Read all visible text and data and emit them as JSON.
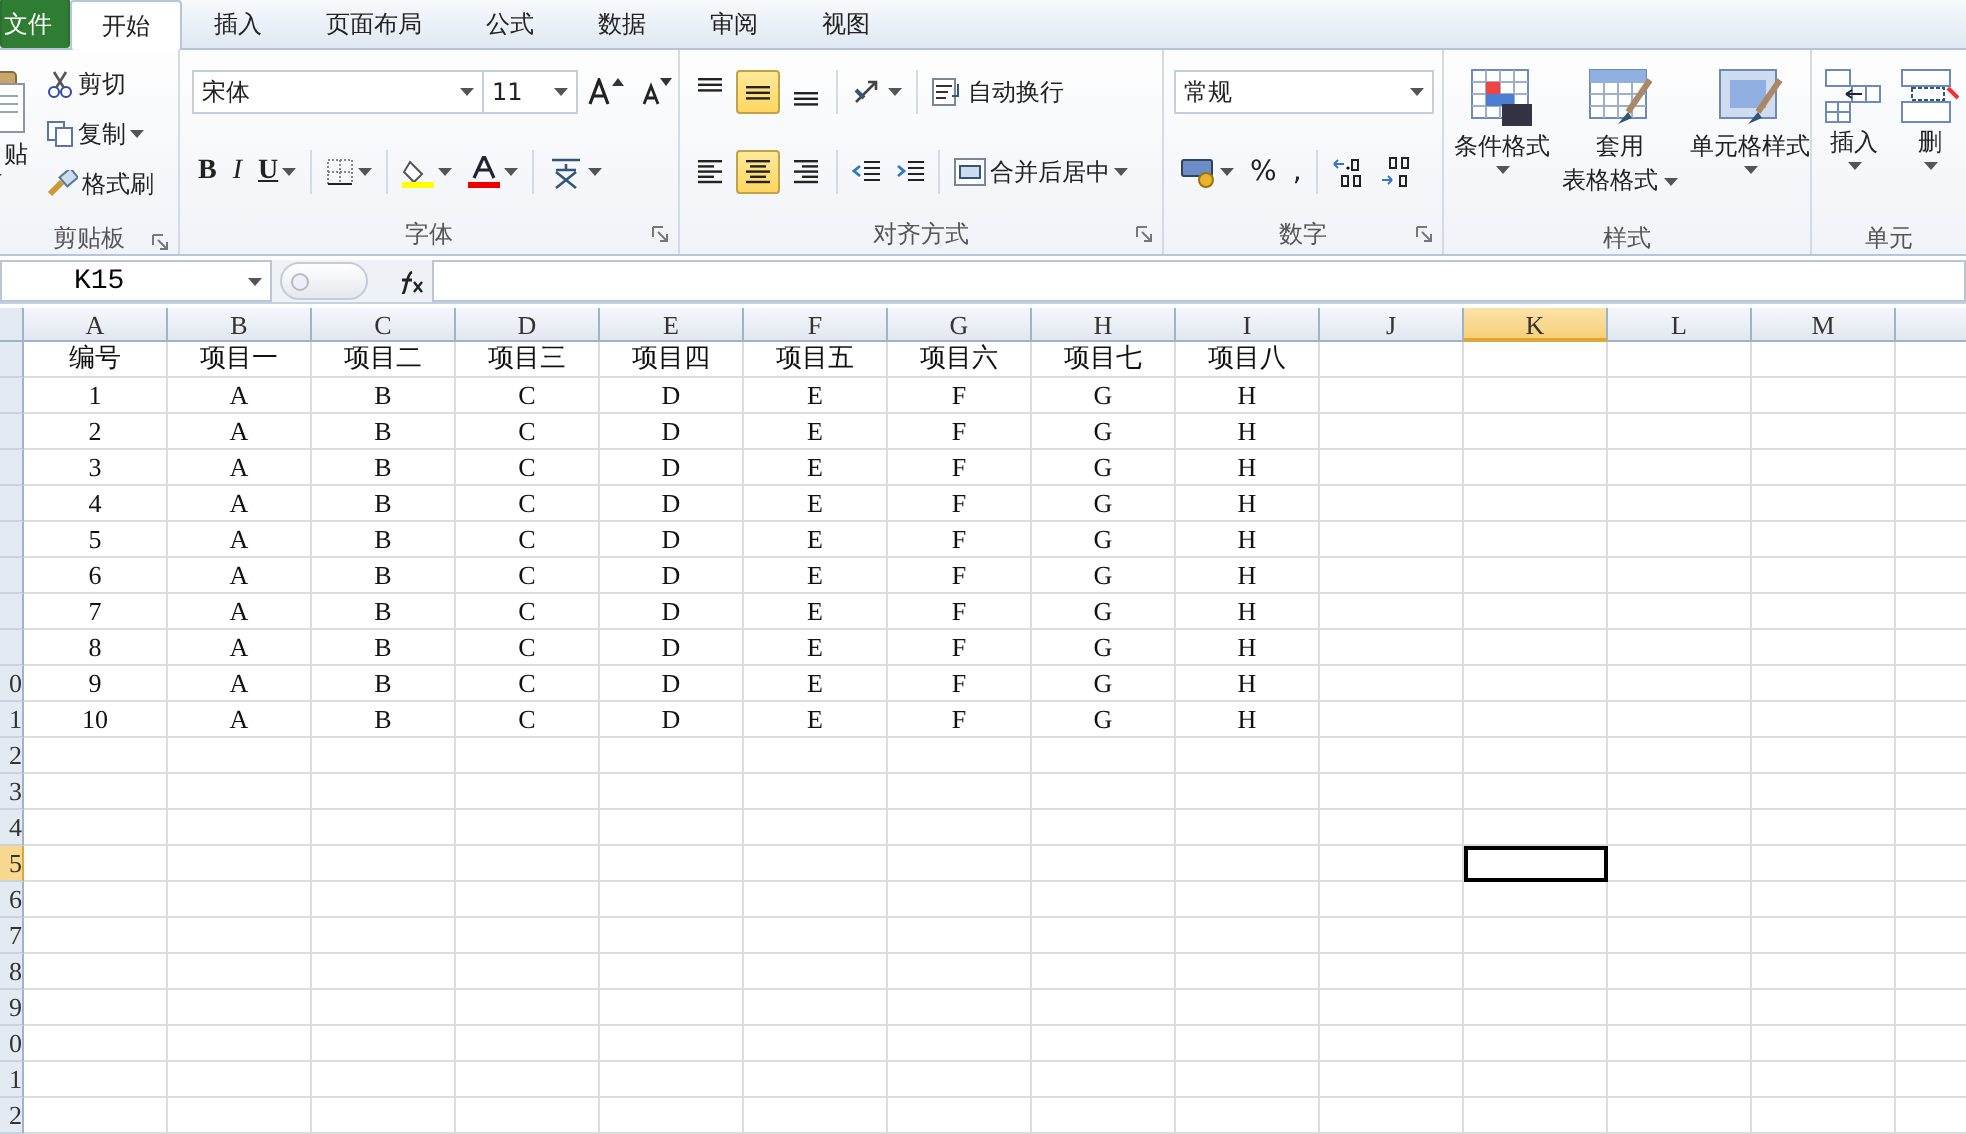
{
  "ribbon": {
    "tabs": [
      {
        "label": "文件",
        "kind": "file",
        "selected": false
      },
      {
        "label": "开始",
        "kind": "tab",
        "selected": true
      },
      {
        "label": "插入",
        "kind": "tab",
        "selected": false
      },
      {
        "label": "页面布局",
        "kind": "tab",
        "selected": false
      },
      {
        "label": "公式",
        "kind": "tab",
        "selected": false
      },
      {
        "label": "数据",
        "kind": "tab",
        "selected": false
      },
      {
        "label": "审阅",
        "kind": "tab",
        "selected": false
      },
      {
        "label": "视图",
        "kind": "tab",
        "selected": false
      }
    ],
    "clipboard": {
      "title": "剪贴板",
      "paste": "贴",
      "cut": "剪切",
      "copy": "复制",
      "format_painter": "格式刷"
    },
    "font": {
      "title": "字体",
      "font_name": "宋体",
      "font_size": "11",
      "bold": "B",
      "italic": "I",
      "underline": "U"
    },
    "alignment": {
      "title": "对齐方式",
      "wrap_text": "自动换行",
      "merge_center": "合并后居中",
      "vertical_buttons": [
        {
          "kind": "top",
          "selected": false
        },
        {
          "kind": "middle",
          "selected": true
        },
        {
          "kind": "bottom",
          "selected": false
        }
      ],
      "horizontal_buttons": [
        {
          "kind": "left",
          "selected": false
        },
        {
          "kind": "center",
          "selected": true
        },
        {
          "kind": "right",
          "selected": false
        }
      ]
    },
    "number": {
      "title": "数字",
      "format": "常规",
      "percent": "%",
      "comma": ","
    },
    "styles": {
      "title": "样式",
      "conditional_format": "条件格式",
      "table_format": [
        "套用",
        "表格格式"
      ],
      "cell_styles": "单元格样式"
    },
    "cells": {
      "title": "单元",
      "insert": "插入",
      "delete": "删"
    }
  },
  "formula_bar": {
    "name_box": "K15"
  },
  "sheet": {
    "columns": [
      {
        "label": "A",
        "selected": false
      },
      {
        "label": "B",
        "selected": false
      },
      {
        "label": "C",
        "selected": false
      },
      {
        "label": "D",
        "selected": false
      },
      {
        "label": "E",
        "selected": false
      },
      {
        "label": "F",
        "selected": false
      },
      {
        "label": "G",
        "selected": false
      },
      {
        "label": "H",
        "selected": false
      },
      {
        "label": "I",
        "selected": false
      },
      {
        "label": "J",
        "selected": false
      },
      {
        "label": "K",
        "selected": true
      },
      {
        "label": "L",
        "selected": false
      },
      {
        "label": "M",
        "selected": false
      }
    ],
    "rows": [
      {
        "selected": false,
        "cells": [
          "编号",
          "项目一",
          "项目二",
          "项目三",
          "项目四",
          "项目五",
          "项目六",
          "项目七",
          "项目八"
        ]
      },
      {
        "selected": false,
        "cells": [
          "1",
          "A",
          "B",
          "C",
          "D",
          "E",
          "F",
          "G",
          "H"
        ]
      },
      {
        "selected": false,
        "cells": [
          "2",
          "A",
          "B",
          "C",
          "D",
          "E",
          "F",
          "G",
          "H"
        ]
      },
      {
        "selected": false,
        "cells": [
          "3",
          "A",
          "B",
          "C",
          "D",
          "E",
          "F",
          "G",
          "H"
        ]
      },
      {
        "selected": false,
        "cells": [
          "4",
          "A",
          "B",
          "C",
          "D",
          "E",
          "F",
          "G",
          "H"
        ]
      },
      {
        "selected": false,
        "cells": [
          "5",
          "A",
          "B",
          "C",
          "D",
          "E",
          "F",
          "G",
          "H"
        ]
      },
      {
        "selected": false,
        "cells": [
          "6",
          "A",
          "B",
          "C",
          "D",
          "E",
          "F",
          "G",
          "H"
        ]
      },
      {
        "selected": false,
        "cells": [
          "7",
          "A",
          "B",
          "C",
          "D",
          "E",
          "F",
          "G",
          "H"
        ]
      },
      {
        "selected": false,
        "cells": [
          "8",
          "A",
          "B",
          "C",
          "D",
          "E",
          "F",
          "G",
          "H"
        ]
      },
      {
        "header": "0",
        "selected": false,
        "cells": [
          "9",
          "A",
          "B",
          "C",
          "D",
          "E",
          "F",
          "G",
          "H"
        ]
      },
      {
        "header": "1",
        "selected": false,
        "cells": [
          "10",
          "A",
          "B",
          "C",
          "D",
          "E",
          "F",
          "G",
          "H"
        ]
      },
      {
        "header": "2",
        "selected": false
      },
      {
        "header": "3",
        "selected": false
      },
      {
        "header": "4",
        "selected": false
      },
      {
        "header": "5",
        "selected": true
      },
      {
        "header": "6",
        "selected": false
      },
      {
        "header": "7",
        "selected": false
      },
      {
        "header": "8",
        "selected": false
      },
      {
        "header": "9",
        "selected": false
      },
      {
        "header": "0",
        "selected": false
      },
      {
        "header": "1",
        "selected": false
      },
      {
        "header": "2",
        "selected": false
      }
    ]
  }
}
